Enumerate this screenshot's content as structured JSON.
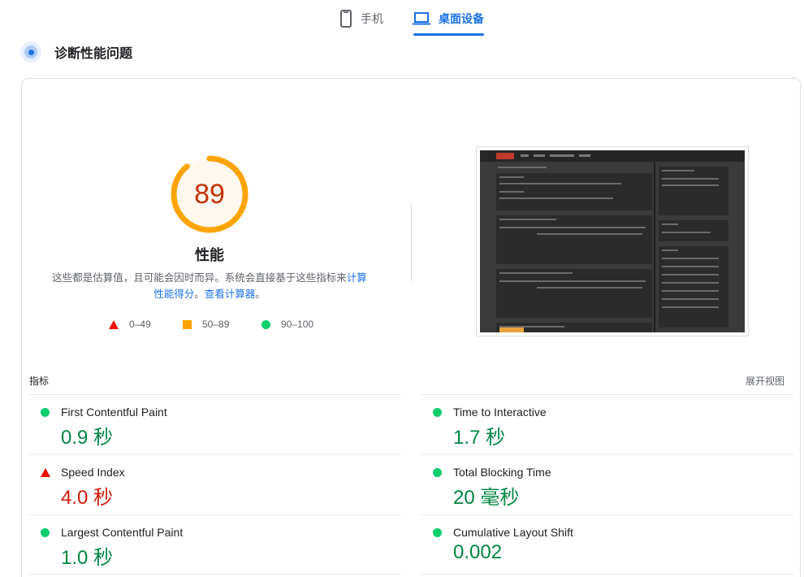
{
  "tabs": [
    {
      "label": "手机",
      "icon": "mobile-phone-icon",
      "active": false
    },
    {
      "label": "桌面设备",
      "icon": "laptop-icon",
      "active": true
    }
  ],
  "diagnostic": {
    "title": "诊断性能问题",
    "icon": "diagnostic-pulse-icon"
  },
  "score": {
    "value": 89,
    "fraction": 0.89,
    "label": "性能",
    "color": "#ffa400",
    "text_color": "#c33300"
  },
  "disclaimer": {
    "text_before": "这些都是估算值，且可能会因时而异。系统会直接基于这些指标来",
    "link_calc": "计算性能得分",
    "text_mid": "。",
    "link_calculator": "查看计算器",
    "text_after": "。"
  },
  "legend": [
    {
      "shape": "triangle",
      "range": "0–49",
      "color": "#eb0f00"
    },
    {
      "shape": "square",
      "range": "50–89",
      "color": "#ffa400"
    },
    {
      "shape": "circle",
      "range": "90–100",
      "color": "#0cce6b"
    }
  ],
  "metrics_header": {
    "title": "指标",
    "expand": "展开视图"
  },
  "metrics": {
    "fcp": {
      "name": "First Contentful Paint",
      "value": "0.9 秒",
      "status": "pass"
    },
    "si": {
      "name": "Speed Index",
      "value": "4.0 秒",
      "status": "fail"
    },
    "lcp": {
      "name": "Largest Contentful Paint",
      "value": "1.0 秒",
      "status": "pass"
    },
    "tti": {
      "name": "Time to Interactive",
      "value": "1.7 秒",
      "status": "pass"
    },
    "tbt": {
      "name": "Total Blocking Time",
      "value": "20 毫秒",
      "status": "pass"
    },
    "cls": {
      "name": "Cumulative Layout Shift",
      "value": "0.002",
      "status": "pass"
    }
  },
  "colors": {
    "accent": "#1a73e8",
    "pass": "#0cce6b",
    "pass_text": "#018642",
    "fail": "#eb0f00",
    "fail_text": "#d01808",
    "average": "#ffa400"
  }
}
